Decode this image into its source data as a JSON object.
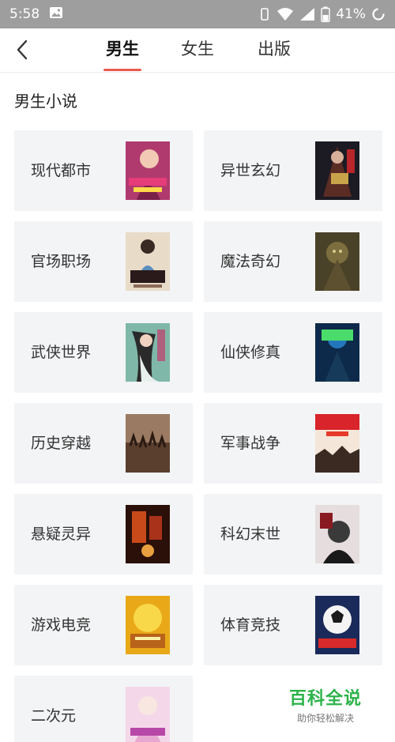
{
  "status_bar": {
    "time": "5:58",
    "battery": "41%"
  },
  "nav": {
    "tabs": [
      {
        "label": "男生",
        "active": true
      },
      {
        "label": "女生",
        "active": false
      },
      {
        "label": "出版",
        "active": false
      }
    ]
  },
  "section": {
    "title": "男生小说"
  },
  "categories": [
    {
      "label": "现代都市"
    },
    {
      "label": "异世玄幻"
    },
    {
      "label": "官场职场"
    },
    {
      "label": "魔法奇幻"
    },
    {
      "label": "武侠世界"
    },
    {
      "label": "仙侠修真"
    },
    {
      "label": "历史穿越"
    },
    {
      "label": "军事战争"
    },
    {
      "label": "悬疑灵异"
    },
    {
      "label": "科幻末世"
    },
    {
      "label": "游戏电竞"
    },
    {
      "label": "体育竞技"
    },
    {
      "label": "二次元"
    }
  ],
  "watermark": {
    "title": "百科全说",
    "subtitle": "助你轻松解决"
  },
  "colors": {
    "accent": "#e85a4f",
    "status_bar": "#9e9e9e",
    "card_bg": "#f3f4f6",
    "watermark_green": "#2db34a"
  }
}
